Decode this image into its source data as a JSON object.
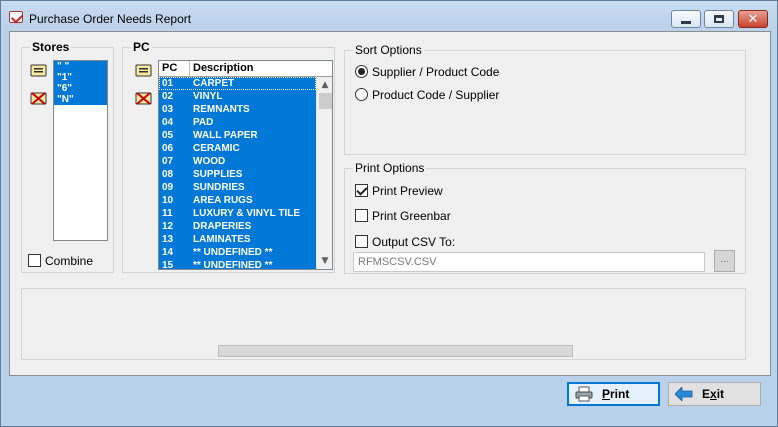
{
  "window": {
    "title": "Purchase Order Needs Report",
    "controls": {
      "minimize": "minimize-icon",
      "maximize": "maximize-icon",
      "close": "close-icon"
    }
  },
  "stores": {
    "label": "Stores",
    "items": [
      "\" \"",
      "\"1\"",
      "\"6\"",
      "\"N\""
    ],
    "combine_label": "Combine",
    "combine_checked": false
  },
  "pc": {
    "label": "PC",
    "columns": {
      "code": "PC",
      "description": "Description"
    },
    "rows": [
      {
        "code": "01",
        "description": "CARPET"
      },
      {
        "code": "02",
        "description": "VINYL"
      },
      {
        "code": "03",
        "description": "REMNANTS"
      },
      {
        "code": "04",
        "description": "PAD"
      },
      {
        "code": "05",
        "description": "WALL PAPER"
      },
      {
        "code": "06",
        "description": "CERAMIC"
      },
      {
        "code": "07",
        "description": "WOOD"
      },
      {
        "code": "08",
        "description": "SUPPLIES"
      },
      {
        "code": "09",
        "description": "SUNDRIES"
      },
      {
        "code": "10",
        "description": "AREA RUGS"
      },
      {
        "code": "11",
        "description": "LUXURY & VINYL TILE"
      },
      {
        "code": "12",
        "description": "DRAPERIES"
      },
      {
        "code": "13",
        "description": "LAMINATES"
      },
      {
        "code": "14",
        "description": "** UNDEFINED **"
      },
      {
        "code": "15",
        "description": "** UNDEFINED **"
      }
    ]
  },
  "sort_options": {
    "label": "Sort Options",
    "choices": [
      "Supplier / Product Code",
      "Product Code / Supplier"
    ],
    "selected_index": 0
  },
  "print_options": {
    "label": "Print Options",
    "print_preview": {
      "label": "Print Preview",
      "checked": true
    },
    "print_greenbar": {
      "label": "Print Greenbar",
      "checked": false
    },
    "output_csv": {
      "label": "Output CSV To:",
      "checked": false
    },
    "csv_path": "RFMSCSV.CSV",
    "browse_label": "..."
  },
  "buttons": {
    "print": "Print",
    "exit": "Exit"
  },
  "colors": {
    "selection": "#0078d7",
    "frame": "#b9d1ea",
    "client": "#f0f0f0"
  }
}
